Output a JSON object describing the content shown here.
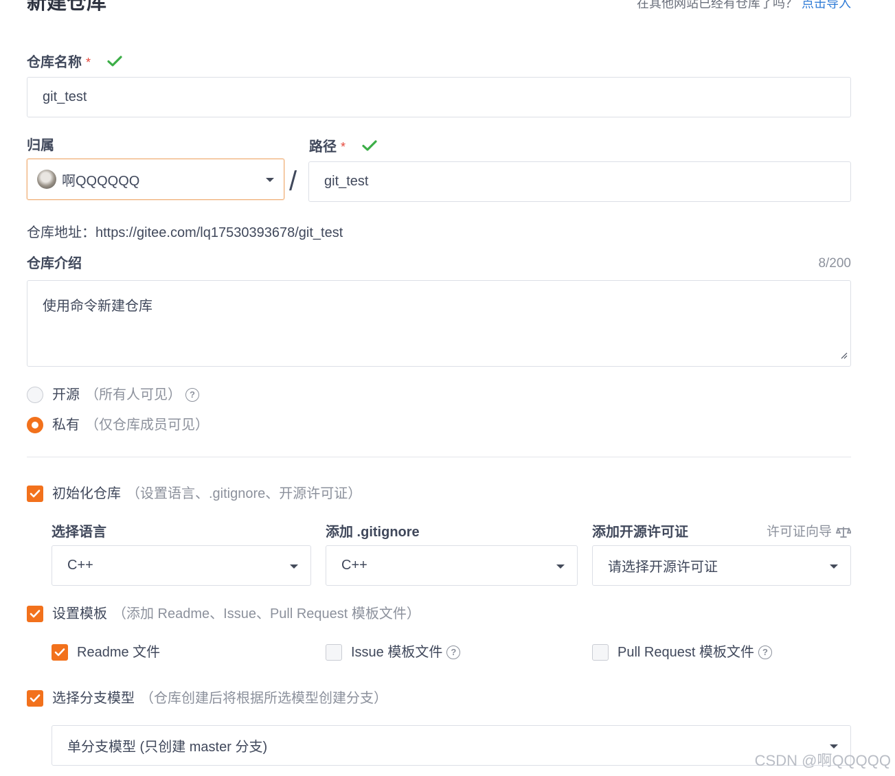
{
  "header": {
    "title": "新建仓库",
    "import_hint": "在其他网站已经有仓库了吗？",
    "import_link": "点击导入"
  },
  "repo_name": {
    "label": "仓库名称",
    "required_mark": "*",
    "value": "git_test"
  },
  "owner": {
    "label": "归属",
    "value": "啊QQQQQQ"
  },
  "path_separator": "/",
  "path": {
    "label": "路径",
    "required_mark": "*",
    "value": "git_test"
  },
  "repo_address": {
    "label": "仓库地址：",
    "value": "https://gitee.com/lq17530393678/git_test"
  },
  "description": {
    "label": "仓库介绍",
    "counter": "8/200",
    "value": "使用命令新建仓库"
  },
  "visibility": {
    "options": [
      {
        "label": "开源",
        "hint": "（所有人可见）",
        "selected": false
      },
      {
        "label": "私有",
        "hint": "（仅仓库成员可见）",
        "selected": true
      }
    ]
  },
  "init_repo": {
    "label": "初始化仓库",
    "hint": "（设置语言、.gitignore、开源许可证）",
    "checked": true,
    "language": {
      "label": "选择语言",
      "value": "C++"
    },
    "gitignore": {
      "label": "添加 .gitignore",
      "value": "C++"
    },
    "license": {
      "label": "添加开源许可证",
      "wizard": "许可证向导",
      "value": "请选择开源许可证"
    }
  },
  "templates": {
    "label": "设置模板",
    "hint": "（添加 Readme、Issue、Pull Request 模板文件）",
    "checked": true,
    "items": [
      {
        "label": "Readme 文件",
        "checked": true
      },
      {
        "label": "Issue 模板文件",
        "checked": false
      },
      {
        "label": "Pull Request 模板文件",
        "checked": false
      }
    ]
  },
  "branch_model": {
    "label": "选择分支模型",
    "hint": "（仓库创建后将根据所选模型创建分支）",
    "checked": true,
    "value": "单分支模型 (只创建 master 分支)"
  },
  "watermark": "CSDN @啊QQQQQ",
  "colors": {
    "accent": "#f2711c",
    "link": "#2d7ad6",
    "success": "#3cae47"
  },
  "icons": [
    "check-icon",
    "chevron-down-icon",
    "question-circle-icon",
    "scale-icon",
    "resize-grip-icon"
  ]
}
